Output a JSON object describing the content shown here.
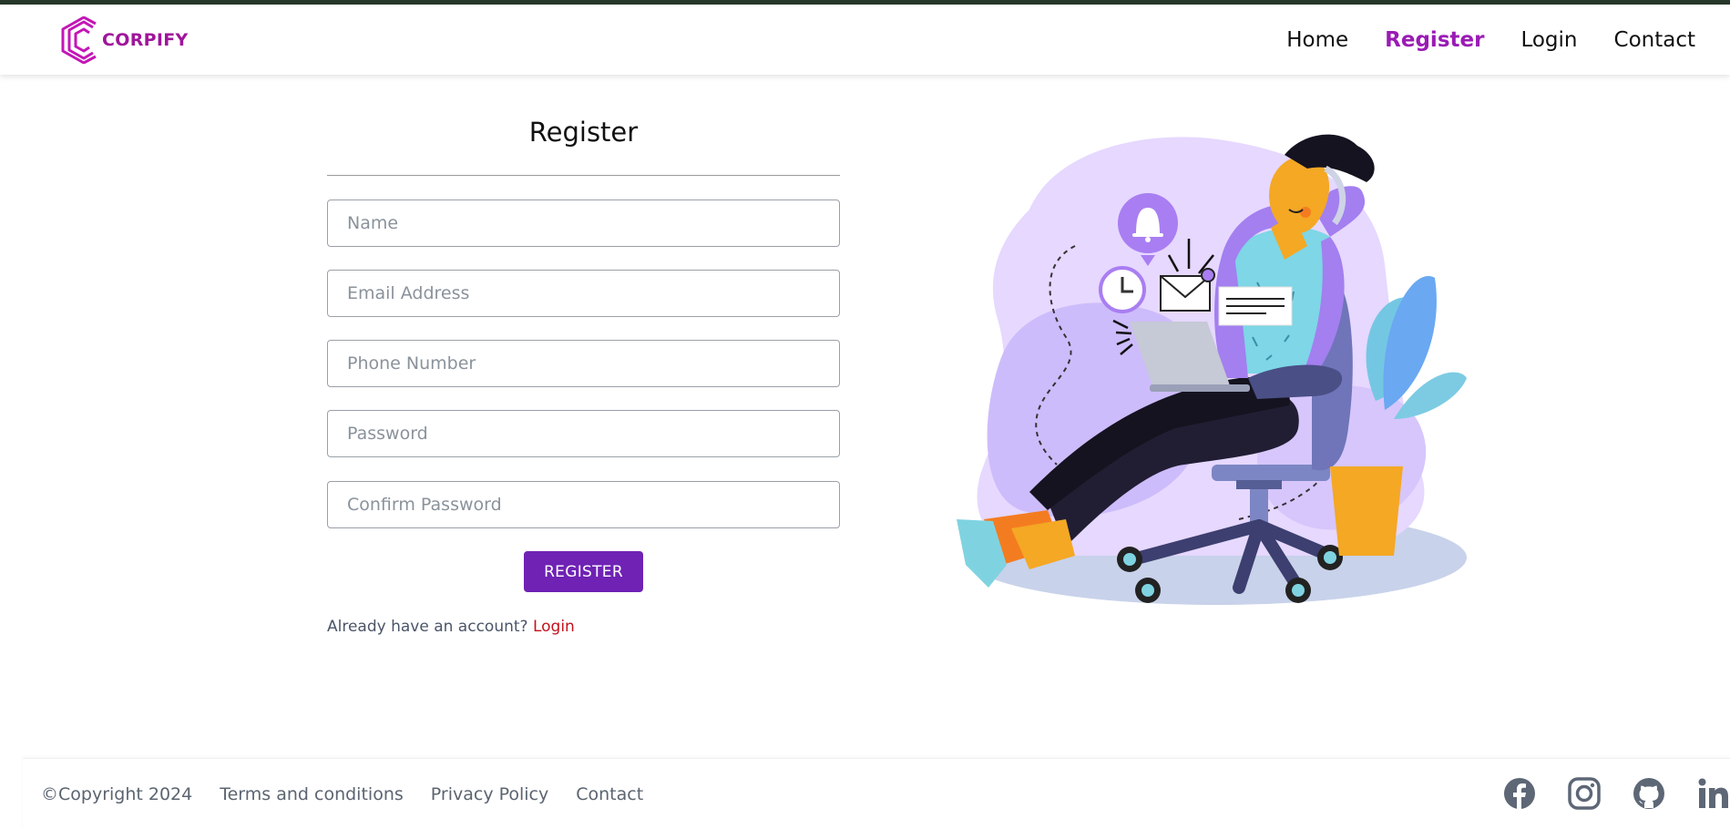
{
  "colors": {
    "brand": "#a0159b",
    "nav_active": "#9a1bb5",
    "button": "#6f22b4",
    "login_link": "#c4121c",
    "top_border": "#26382a"
  },
  "brand": {
    "name": "CORPIFY",
    "icon": "corpify-logo-icon"
  },
  "nav": {
    "items": [
      {
        "label": "Home",
        "active": false
      },
      {
        "label": "Register",
        "active": true
      },
      {
        "label": "Login",
        "active": false
      },
      {
        "label": "Contact",
        "active": false
      }
    ]
  },
  "form": {
    "title": "Register",
    "fields": {
      "name": {
        "value": "",
        "placeholder": "Name"
      },
      "email": {
        "value": "",
        "placeholder": "Email Address"
      },
      "phone": {
        "value": "",
        "placeholder": "Phone Number"
      },
      "password": {
        "value": "",
        "placeholder": "Password"
      },
      "confirm_password": {
        "value": "",
        "placeholder": "Confirm Password"
      }
    },
    "submit_label": "REGISTER",
    "account_prompt": "Already have an account?",
    "login_link": "Login"
  },
  "illustration": {
    "icon": "person-relaxing-in-chair-illustration"
  },
  "footer": {
    "copyright": "©Copyright 2024",
    "links": [
      "Terms and conditions",
      "Privacy Policy",
      "Contact"
    ],
    "socials": [
      "facebook-icon",
      "instagram-icon",
      "github-icon",
      "linkedin-icon"
    ]
  }
}
